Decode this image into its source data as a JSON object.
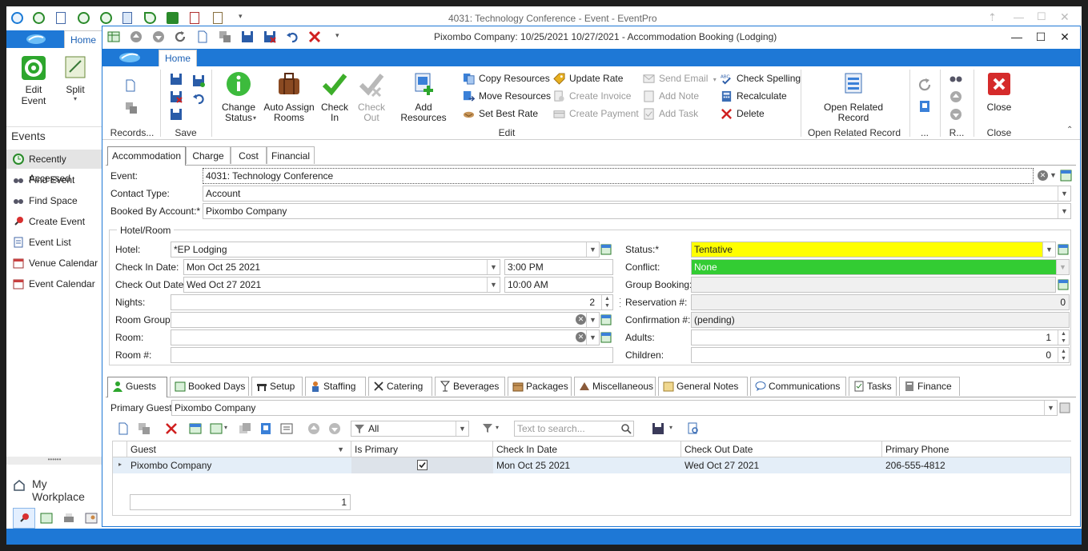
{
  "app": {
    "title": "4031: Technology Conference - Event - EventPro",
    "home_tab": "Home",
    "edit_event_label": "Edit Event",
    "split_label": "Split",
    "events_header": "Events",
    "nav_items": [
      {
        "label": "Recently Accessed",
        "icon": "clock-icon"
      },
      {
        "label": "Find Event",
        "icon": "binoculars-icon"
      },
      {
        "label": "Find Space",
        "icon": "binoculars-icon"
      },
      {
        "label": "Create Event",
        "icon": "pushpin-icon"
      },
      {
        "label": "Event List",
        "icon": "document-icon"
      },
      {
        "label": "Venue Calendar",
        "icon": "calendar-icon"
      },
      {
        "label": "Event Calendar",
        "icon": "calendar-icon"
      }
    ],
    "workplace_label": "My Workplace"
  },
  "dialog": {
    "title": "Pixombo Company:  10/25/2021 10/27/2021  - Accommodation Booking (Lodging)",
    "home_tab": "Home",
    "ribbon": {
      "records_label": "Records...",
      "save_label": "Save",
      "change_status": "Change Status",
      "auto_assign": "Auto Assign Rooms",
      "check_in": "Check In",
      "check_out": "Check Out",
      "add_resources": "Add Resources",
      "copy_resources": "Copy Resources",
      "move_resources": "Move Resources",
      "set_best_rate": "Set Best Rate",
      "update_rate": "Update Rate",
      "create_invoice": "Create Invoice",
      "create_payment": "Create Payment",
      "send_email": "Send Email",
      "add_note": "Add Note",
      "add_task": "Add Task",
      "check_spelling": "Check Spelling",
      "recalculate": "Recalculate",
      "delete": "Delete",
      "edit_group": "Edit",
      "open_related_record": "Open Related Record",
      "open_related_group": "Open Related Record",
      "dots_group": "...",
      "r_group": "R...",
      "close": "Close",
      "close_group": "Close"
    },
    "tabs": [
      "Accommodation",
      "Charge",
      "Cost",
      "Financial"
    ],
    "form": {
      "event_label": "Event:",
      "event_value": "4031: Technology Conference",
      "contact_type_label": "Contact Type:",
      "contact_type_value": "Account",
      "booked_by_label": "Booked By Account:*",
      "booked_by_value": "Pixombo Company",
      "hotel_room_group": "Hotel/Room",
      "hotel_label": "Hotel:",
      "hotel_value": "*EP Lodging",
      "check_in_label": "Check In Date:",
      "check_in_date": "Mon Oct 25 2021",
      "check_in_time": "3:00 PM",
      "check_out_label": "Check Out Date:",
      "check_out_date": "Wed Oct 27 2021",
      "check_out_time": "10:00 AM",
      "nights_label": "Nights:",
      "nights_value": "2",
      "room_group_label": "Room Group:",
      "room_label": "Room:",
      "room_no_label": "Room #:",
      "status_label": "Status:*",
      "status_value": "Tentative",
      "status_color": "#ffff00",
      "conflict_label": "Conflict:",
      "conflict_value": "None",
      "conflict_color": "#33cc33",
      "group_booking_label": "Group Booking:",
      "reservation_label": "Reservation #:",
      "reservation_value": "0",
      "confirmation_label": "Confirmation #:",
      "confirmation_value": "(pending)",
      "adults_label": "Adults:",
      "adults_value": "1",
      "children_label": "Children:",
      "children_value": "0"
    },
    "bottom_tabs": [
      {
        "label": "Guests",
        "icon": "person-icon"
      },
      {
        "label": "Booked Days",
        "icon": "calendar-days-icon"
      },
      {
        "label": "Setup",
        "icon": "table-setup-icon"
      },
      {
        "label": "Staffing",
        "icon": "staff-icon"
      },
      {
        "label": "Catering",
        "icon": "utensils-icon"
      },
      {
        "label": "Beverages",
        "icon": "glass-icon"
      },
      {
        "label": "Packages",
        "icon": "package-icon"
      },
      {
        "label": "Miscellaneous",
        "icon": "misc-icon"
      },
      {
        "label": "General Notes",
        "icon": "notes-icon"
      },
      {
        "label": "Communications",
        "icon": "speech-icon"
      },
      {
        "label": "Tasks",
        "icon": "tasks-icon"
      },
      {
        "label": "Finance",
        "icon": "calculator-icon"
      }
    ],
    "guests": {
      "primary_guest_label": "Primary Guest:",
      "primary_guest_value": "Pixombo Company",
      "filter_value": "All",
      "search_placeholder": "Text to search...",
      "columns": [
        "Guest",
        "Is Primary",
        "Check In Date",
        "Check Out Date",
        "Primary Phone"
      ],
      "rows": [
        {
          "guest": "Pixombo Company",
          "is_primary": true,
          "check_in": "Mon Oct 25 2021",
          "check_out": "Wed Oct 27 2021",
          "phone": "206-555-4812"
        }
      ],
      "count": "1"
    }
  }
}
